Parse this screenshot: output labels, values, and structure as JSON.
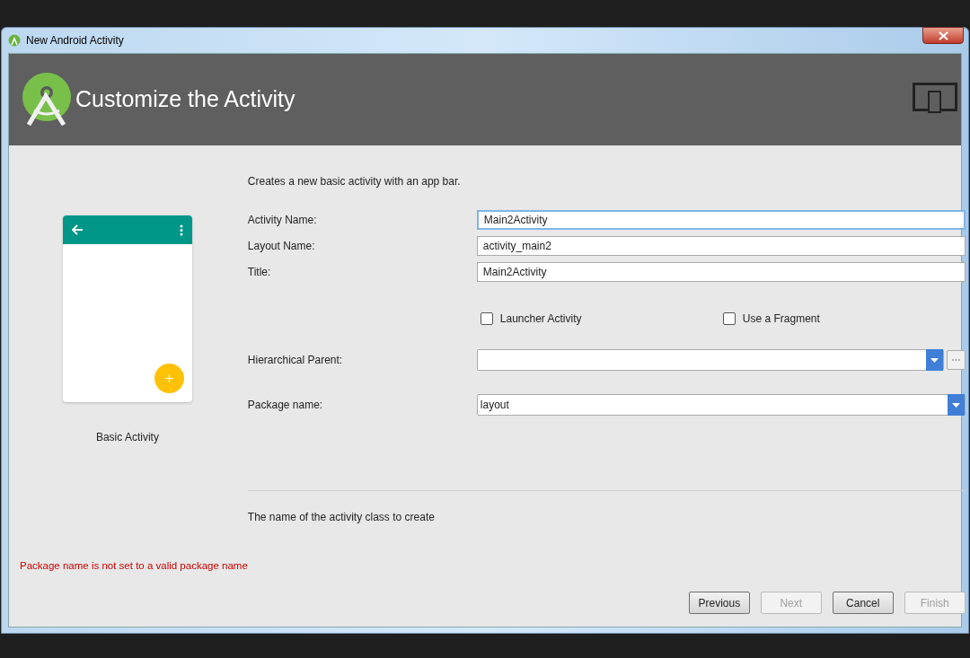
{
  "window": {
    "title": "New Android Activity"
  },
  "header": {
    "title": "Customize the Activity"
  },
  "preview": {
    "label": "Basic Activity"
  },
  "description": "Creates a new basic activity with an app bar.",
  "fields": [
    {
      "kind": "text",
      "label": "Activity Name:",
      "value": "Main2Activity",
      "focused": true
    },
    {
      "kind": "text",
      "label": "Layout Name:",
      "value": "activity_main2",
      "focused": false
    },
    {
      "kind": "text",
      "label": "Title:",
      "value": "Main2Activity",
      "focused": false
    }
  ],
  "checkboxes": [
    {
      "label": "Launcher Activity",
      "checked": false
    },
    {
      "label": "Use a Fragment",
      "checked": false
    }
  ],
  "selects": [
    {
      "label": "Hierarchical Parent:",
      "browse": true
    },
    {
      "label": "Package name:",
      "value": "layout",
      "browse": false
    }
  ],
  "help": "The name of the activity class to create",
  "error": "Package name is not set to a valid package name",
  "buttons": [
    {
      "label": "Previous",
      "disabled": false
    },
    {
      "label": "Next",
      "disabled": true
    },
    {
      "label": "Cancel",
      "disabled": false
    },
    {
      "label": "Finish",
      "disabled": true
    }
  ]
}
